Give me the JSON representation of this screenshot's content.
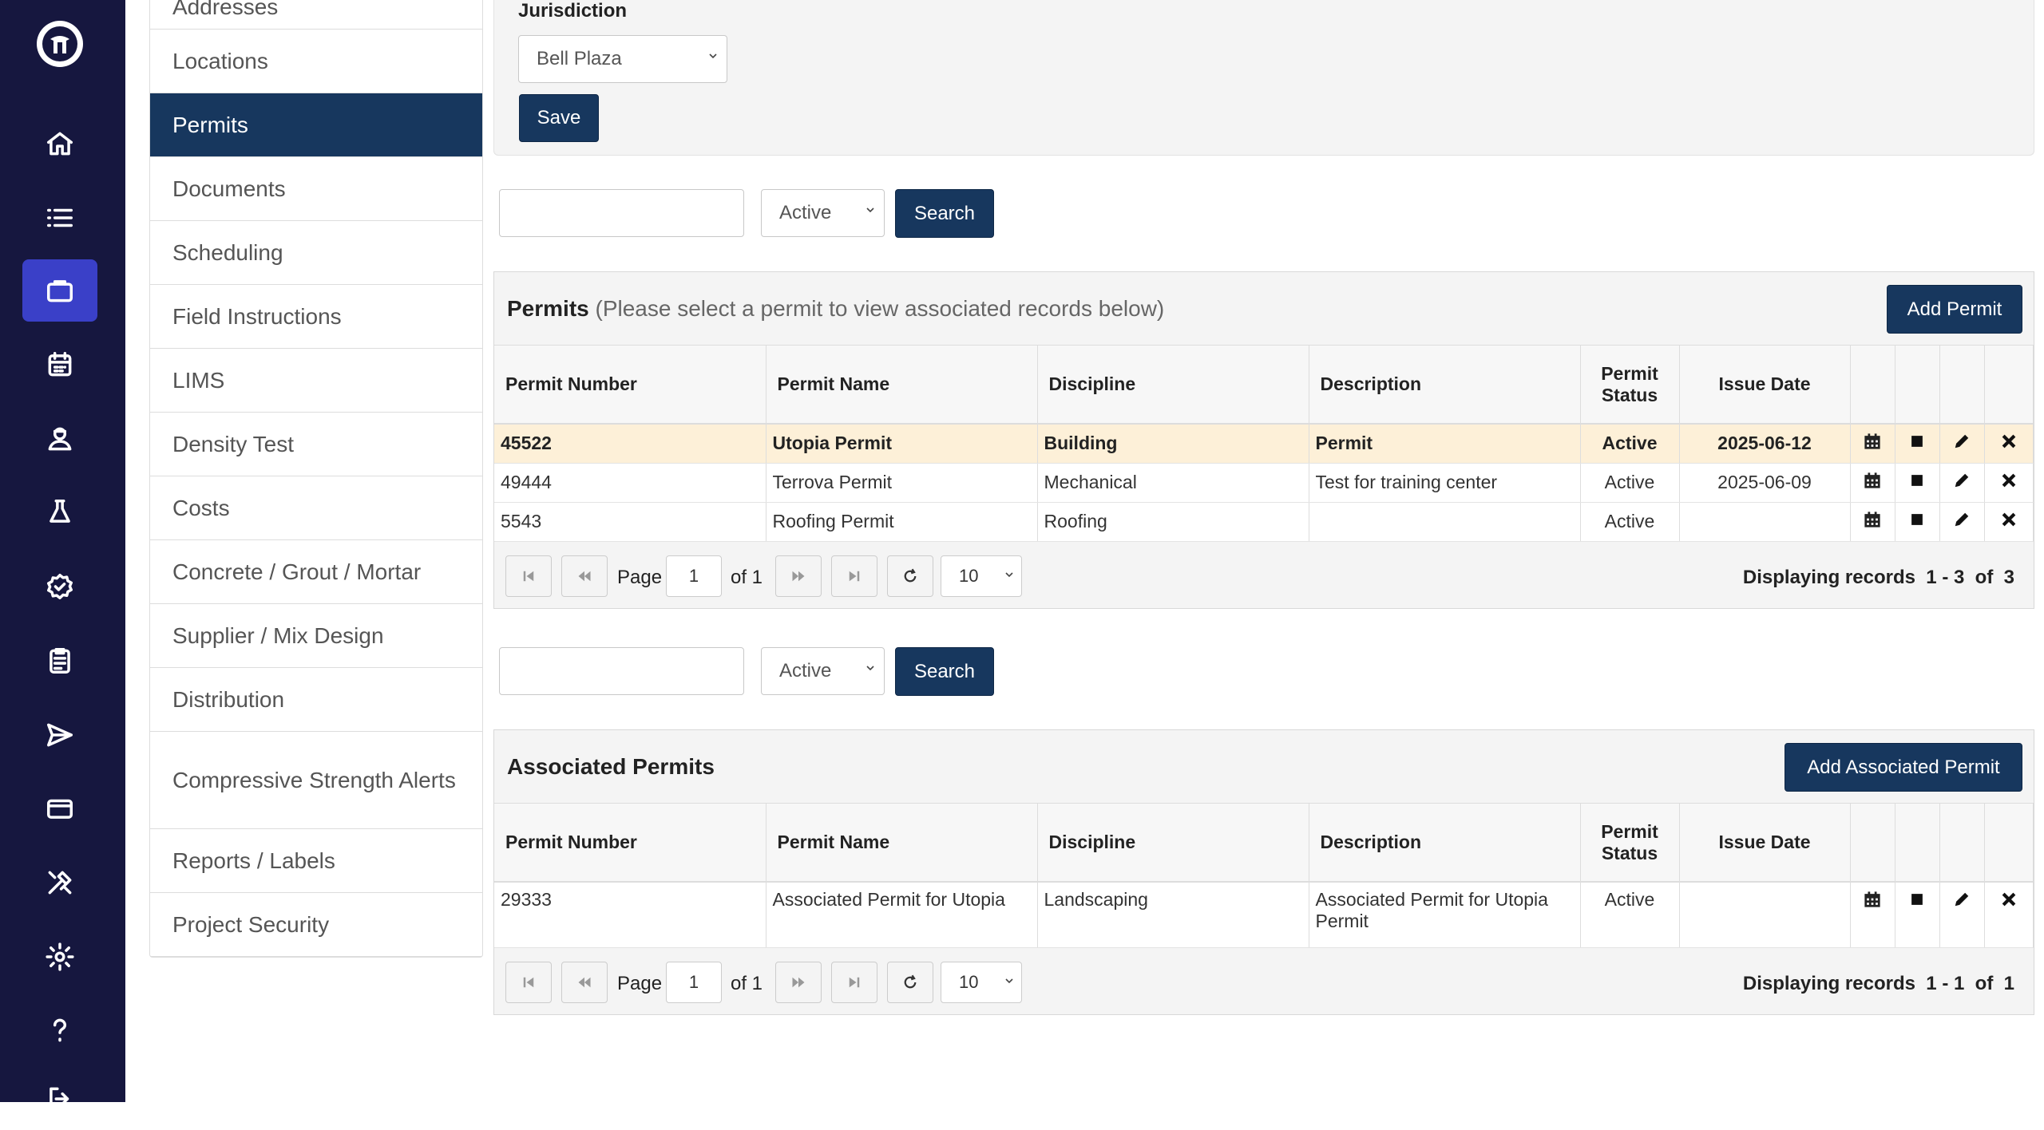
{
  "nav": {
    "icons": [
      "logo-icon",
      "home-icon",
      "list-icon",
      "briefcase-icon",
      "calendar-icon",
      "user-icon",
      "flask-icon",
      "badge-check-icon",
      "clipboard-icon",
      "send-icon",
      "credit-card-icon",
      "tools-icon",
      "gear-icon",
      "question-icon",
      "logout-icon"
    ],
    "active": "briefcase-icon"
  },
  "menu": {
    "items": [
      {
        "label": "Addresses"
      },
      {
        "label": "Locations"
      },
      {
        "label": "Permits"
      },
      {
        "label": "Documents"
      },
      {
        "label": "Scheduling"
      },
      {
        "label": "Field Instructions"
      },
      {
        "label": "LIMS"
      },
      {
        "label": "Density Test"
      },
      {
        "label": "Costs"
      },
      {
        "label": "Concrete / Grout / Mortar"
      },
      {
        "label": "Supplier / Mix Design"
      },
      {
        "label": "Distribution"
      },
      {
        "label": "Compressive Strength Alerts"
      },
      {
        "label": "Reports / Labels"
      },
      {
        "label": "Project Security"
      }
    ],
    "active_label": "Permits"
  },
  "jurisdiction": {
    "label": "Jurisdiction",
    "value": "Bell Plaza",
    "save_label": "Save"
  },
  "search1": {
    "value": "",
    "status": "Active",
    "button": "Search"
  },
  "permits": {
    "title": "Permits",
    "note": "(Please select a permit to view associated records below)",
    "add_label": "Add Permit",
    "columns": [
      "Permit Number",
      "Permit Name",
      "Discipline",
      "Description",
      "Permit Status",
      "Issue Date"
    ],
    "rows": [
      {
        "number": "45522",
        "name": "Utopia Permit",
        "discipline": "Building",
        "description": "Permit",
        "status": "Active",
        "date": "2025-06-12",
        "selected": true
      },
      {
        "number": "49444",
        "name": "Terrova Permit",
        "discipline": "Mechanical",
        "description": "Test for training center",
        "status": "Active",
        "date": "2025-06-09",
        "selected": false
      },
      {
        "number": "5543",
        "name": "Roofing Permit",
        "discipline": "Roofing",
        "description": "",
        "status": "Active",
        "date": "",
        "selected": false
      }
    ],
    "pager": {
      "page_label": "Page",
      "page": "1",
      "of_label": "of 1",
      "per_page": "10",
      "display": "Displaying records  1 - 3  of  3"
    }
  },
  "search2": {
    "value": "",
    "status": "Active",
    "button": "Search"
  },
  "associated": {
    "title": "Associated Permits",
    "add_label": "Add Associated Permit",
    "columns": [
      "Permit Number",
      "Permit Name",
      "Discipline",
      "Description",
      "Permit Status",
      "Issue Date"
    ],
    "rows": [
      {
        "number": "29333",
        "name": "Associated Permit for Utopia",
        "discipline": "Landscaping",
        "description": "Associated Permit for Utopia Permit",
        "status": "Active",
        "date": ""
      }
    ],
    "pager": {
      "page_label": "Page",
      "page": "1",
      "of_label": "of 1",
      "per_page": "10",
      "display": "Displaying records  1 - 1  of  1"
    }
  },
  "colors": {
    "rail": "#16173f",
    "rail_active": "#3a40c8",
    "primary": "#17375e",
    "highlight_row": "#fdf0d8"
  }
}
